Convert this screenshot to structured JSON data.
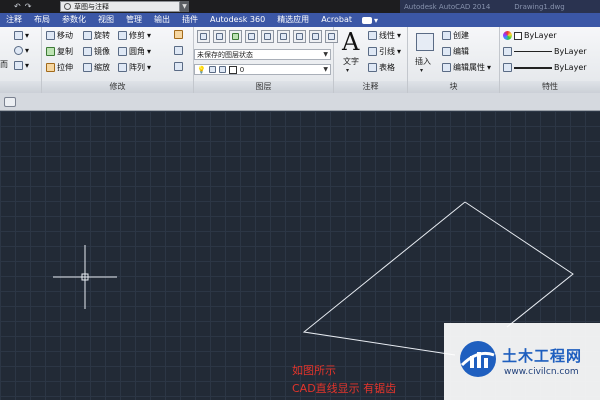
{
  "titlebar": {
    "workspace": "草图与注释",
    "product": "Autodesk AutoCAD 2014",
    "document": "Drawing1.dwg"
  },
  "tabs": [
    "注释",
    "布局",
    "参数化",
    "视图",
    "管理",
    "输出",
    "插件",
    "Autodesk 360",
    "精选应用",
    "Acrobat"
  ],
  "modify_panel": {
    "title": "修改",
    "row1": [
      "移动",
      "旋转",
      "修剪"
    ],
    "row2": [
      "复制",
      "镜像",
      "圆角"
    ],
    "row3": [
      "拉伸",
      "缩放",
      "阵列"
    ]
  },
  "layers_panel": {
    "title": "图层",
    "layer_state": "未保存的图层状态",
    "current_layer": "0"
  },
  "annotation_panel": {
    "title": "注释",
    "text_label": "文字",
    "linear": "线性",
    "leader": "引线",
    "table": "表格"
  },
  "block_panel": {
    "title": "块",
    "insert": "插入",
    "create": "创建",
    "edit": "编辑",
    "edit_attributes": "编辑属性"
  },
  "properties_panel": {
    "title": "特性",
    "color": "ByLayer",
    "linetype": "ByLayer",
    "lineweight": "ByLayer"
  },
  "annotation_note": {
    "line1": "如图所示",
    "line2": "CAD直线显示 有锯齿"
  },
  "watermark": {
    "title": "土木工程网",
    "url": "www.civilcn.com"
  },
  "colors": {
    "canvas": "#222a36",
    "ribbon_tab_bar": "#3b57a6",
    "annotation_text": "#e2342b",
    "lines": "#e8ecf2"
  }
}
